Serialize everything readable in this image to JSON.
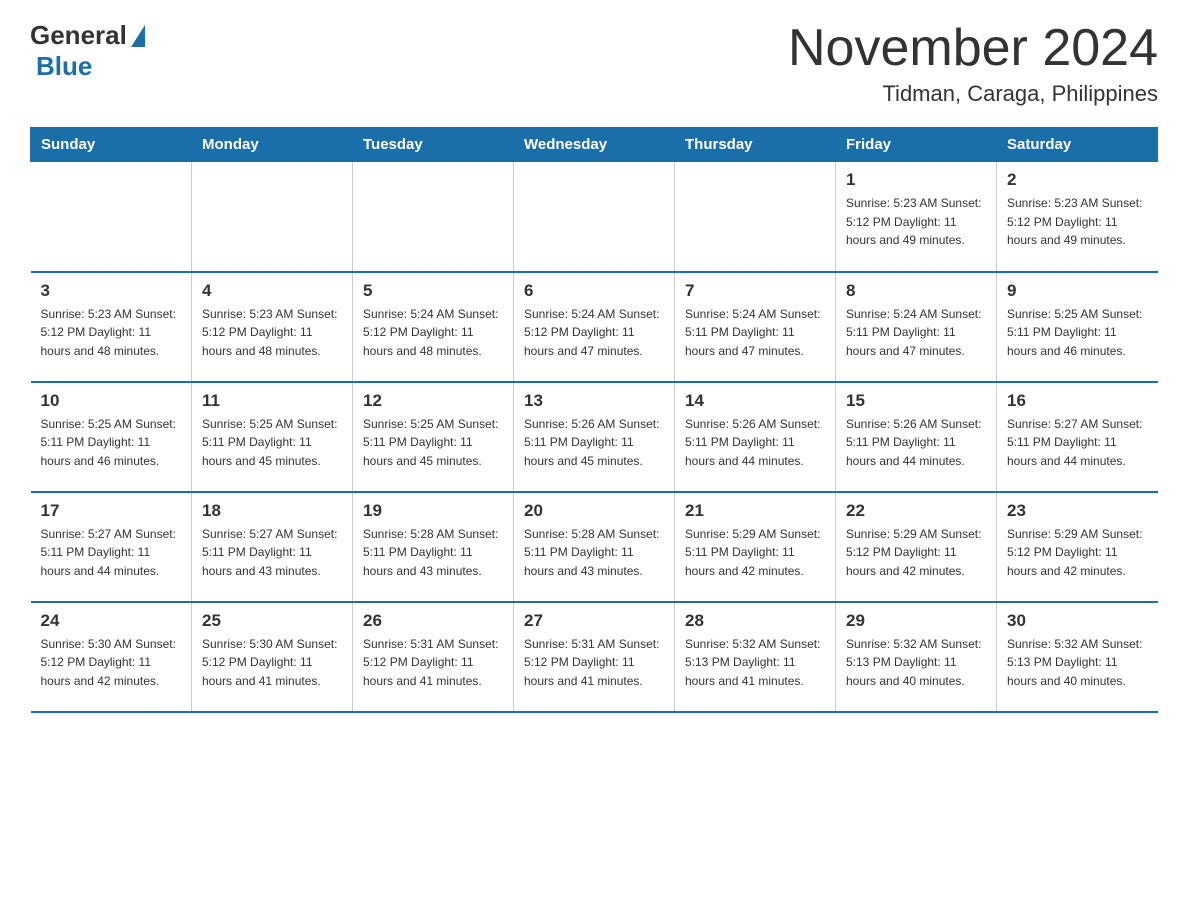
{
  "header": {
    "logo_general": "General",
    "logo_blue": "Blue",
    "month": "November 2024",
    "location": "Tidman, Caraga, Philippines"
  },
  "days_of_week": [
    "Sunday",
    "Monday",
    "Tuesday",
    "Wednesday",
    "Thursday",
    "Friday",
    "Saturday"
  ],
  "weeks": [
    [
      {
        "day": "",
        "info": ""
      },
      {
        "day": "",
        "info": ""
      },
      {
        "day": "",
        "info": ""
      },
      {
        "day": "",
        "info": ""
      },
      {
        "day": "",
        "info": ""
      },
      {
        "day": "1",
        "info": "Sunrise: 5:23 AM\nSunset: 5:12 PM\nDaylight: 11 hours and 49 minutes."
      },
      {
        "day": "2",
        "info": "Sunrise: 5:23 AM\nSunset: 5:12 PM\nDaylight: 11 hours and 49 minutes."
      }
    ],
    [
      {
        "day": "3",
        "info": "Sunrise: 5:23 AM\nSunset: 5:12 PM\nDaylight: 11 hours and 48 minutes."
      },
      {
        "day": "4",
        "info": "Sunrise: 5:23 AM\nSunset: 5:12 PM\nDaylight: 11 hours and 48 minutes."
      },
      {
        "day": "5",
        "info": "Sunrise: 5:24 AM\nSunset: 5:12 PM\nDaylight: 11 hours and 48 minutes."
      },
      {
        "day": "6",
        "info": "Sunrise: 5:24 AM\nSunset: 5:12 PM\nDaylight: 11 hours and 47 minutes."
      },
      {
        "day": "7",
        "info": "Sunrise: 5:24 AM\nSunset: 5:11 PM\nDaylight: 11 hours and 47 minutes."
      },
      {
        "day": "8",
        "info": "Sunrise: 5:24 AM\nSunset: 5:11 PM\nDaylight: 11 hours and 47 minutes."
      },
      {
        "day": "9",
        "info": "Sunrise: 5:25 AM\nSunset: 5:11 PM\nDaylight: 11 hours and 46 minutes."
      }
    ],
    [
      {
        "day": "10",
        "info": "Sunrise: 5:25 AM\nSunset: 5:11 PM\nDaylight: 11 hours and 46 minutes."
      },
      {
        "day": "11",
        "info": "Sunrise: 5:25 AM\nSunset: 5:11 PM\nDaylight: 11 hours and 45 minutes."
      },
      {
        "day": "12",
        "info": "Sunrise: 5:25 AM\nSunset: 5:11 PM\nDaylight: 11 hours and 45 minutes."
      },
      {
        "day": "13",
        "info": "Sunrise: 5:26 AM\nSunset: 5:11 PM\nDaylight: 11 hours and 45 minutes."
      },
      {
        "day": "14",
        "info": "Sunrise: 5:26 AM\nSunset: 5:11 PM\nDaylight: 11 hours and 44 minutes."
      },
      {
        "day": "15",
        "info": "Sunrise: 5:26 AM\nSunset: 5:11 PM\nDaylight: 11 hours and 44 minutes."
      },
      {
        "day": "16",
        "info": "Sunrise: 5:27 AM\nSunset: 5:11 PM\nDaylight: 11 hours and 44 minutes."
      }
    ],
    [
      {
        "day": "17",
        "info": "Sunrise: 5:27 AM\nSunset: 5:11 PM\nDaylight: 11 hours and 44 minutes."
      },
      {
        "day": "18",
        "info": "Sunrise: 5:27 AM\nSunset: 5:11 PM\nDaylight: 11 hours and 43 minutes."
      },
      {
        "day": "19",
        "info": "Sunrise: 5:28 AM\nSunset: 5:11 PM\nDaylight: 11 hours and 43 minutes."
      },
      {
        "day": "20",
        "info": "Sunrise: 5:28 AM\nSunset: 5:11 PM\nDaylight: 11 hours and 43 minutes."
      },
      {
        "day": "21",
        "info": "Sunrise: 5:29 AM\nSunset: 5:11 PM\nDaylight: 11 hours and 42 minutes."
      },
      {
        "day": "22",
        "info": "Sunrise: 5:29 AM\nSunset: 5:12 PM\nDaylight: 11 hours and 42 minutes."
      },
      {
        "day": "23",
        "info": "Sunrise: 5:29 AM\nSunset: 5:12 PM\nDaylight: 11 hours and 42 minutes."
      }
    ],
    [
      {
        "day": "24",
        "info": "Sunrise: 5:30 AM\nSunset: 5:12 PM\nDaylight: 11 hours and 42 minutes."
      },
      {
        "day": "25",
        "info": "Sunrise: 5:30 AM\nSunset: 5:12 PM\nDaylight: 11 hours and 41 minutes."
      },
      {
        "day": "26",
        "info": "Sunrise: 5:31 AM\nSunset: 5:12 PM\nDaylight: 11 hours and 41 minutes."
      },
      {
        "day": "27",
        "info": "Sunrise: 5:31 AM\nSunset: 5:12 PM\nDaylight: 11 hours and 41 minutes."
      },
      {
        "day": "28",
        "info": "Sunrise: 5:32 AM\nSunset: 5:13 PM\nDaylight: 11 hours and 41 minutes."
      },
      {
        "day": "29",
        "info": "Sunrise: 5:32 AM\nSunset: 5:13 PM\nDaylight: 11 hours and 40 minutes."
      },
      {
        "day": "30",
        "info": "Sunrise: 5:32 AM\nSunset: 5:13 PM\nDaylight: 11 hours and 40 minutes."
      }
    ]
  ]
}
